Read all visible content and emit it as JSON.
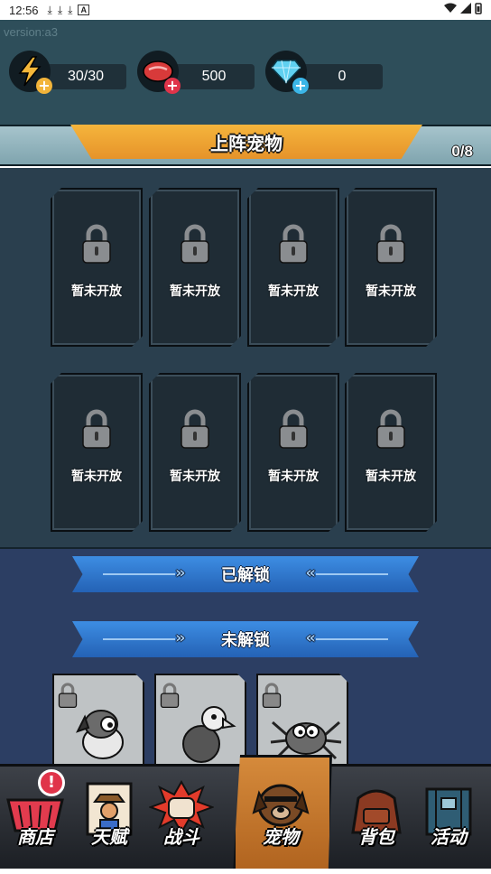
{
  "status_bar": {
    "time": "12:56",
    "downloads": [
      "⤓",
      "⤓",
      "⤓"
    ],
    "app_icon": "A"
  },
  "version": "version:a3",
  "resources": [
    {
      "name": "energy",
      "value": "30/30",
      "icon": "lightning-icon",
      "plus_color": "#f2b43a"
    },
    {
      "name": "meat",
      "value": "500",
      "icon": "meat-icon",
      "plus_color": "#e0344a"
    },
    {
      "name": "diamond",
      "value": "0",
      "icon": "diamond-icon",
      "plus_color": "#3bb6e8"
    }
  ],
  "banner": {
    "title": "上阵宠物",
    "count": "0/8"
  },
  "slots": [
    {
      "label": "暂未开放"
    },
    {
      "label": "暂未开放"
    },
    {
      "label": "暂未开放"
    },
    {
      "label": "暂未开放"
    },
    {
      "label": "暂未开放"
    },
    {
      "label": "暂未开放"
    },
    {
      "label": "暂未开放"
    },
    {
      "label": "暂未开放"
    }
  ],
  "sections": {
    "unlocked": "已解锁",
    "locked": "未解锁"
  },
  "locked_pets": [
    {
      "name": "dog-pet",
      "icon": "dog-pet-icon"
    },
    {
      "name": "vulture-pet",
      "icon": "vulture-pet-icon"
    },
    {
      "name": "spider-pet",
      "icon": "spider-pet-icon"
    }
  ],
  "nav": {
    "shop": "商店",
    "talent": "天赋",
    "battle": "战斗",
    "pet": "宠物",
    "bag": "背包",
    "activity": "活动",
    "shop_alert": "!"
  },
  "colors": {
    "accent_orange": "#e6932a",
    "ribbon_blue": "#2f78d0",
    "nav_active": "#c57a30"
  }
}
